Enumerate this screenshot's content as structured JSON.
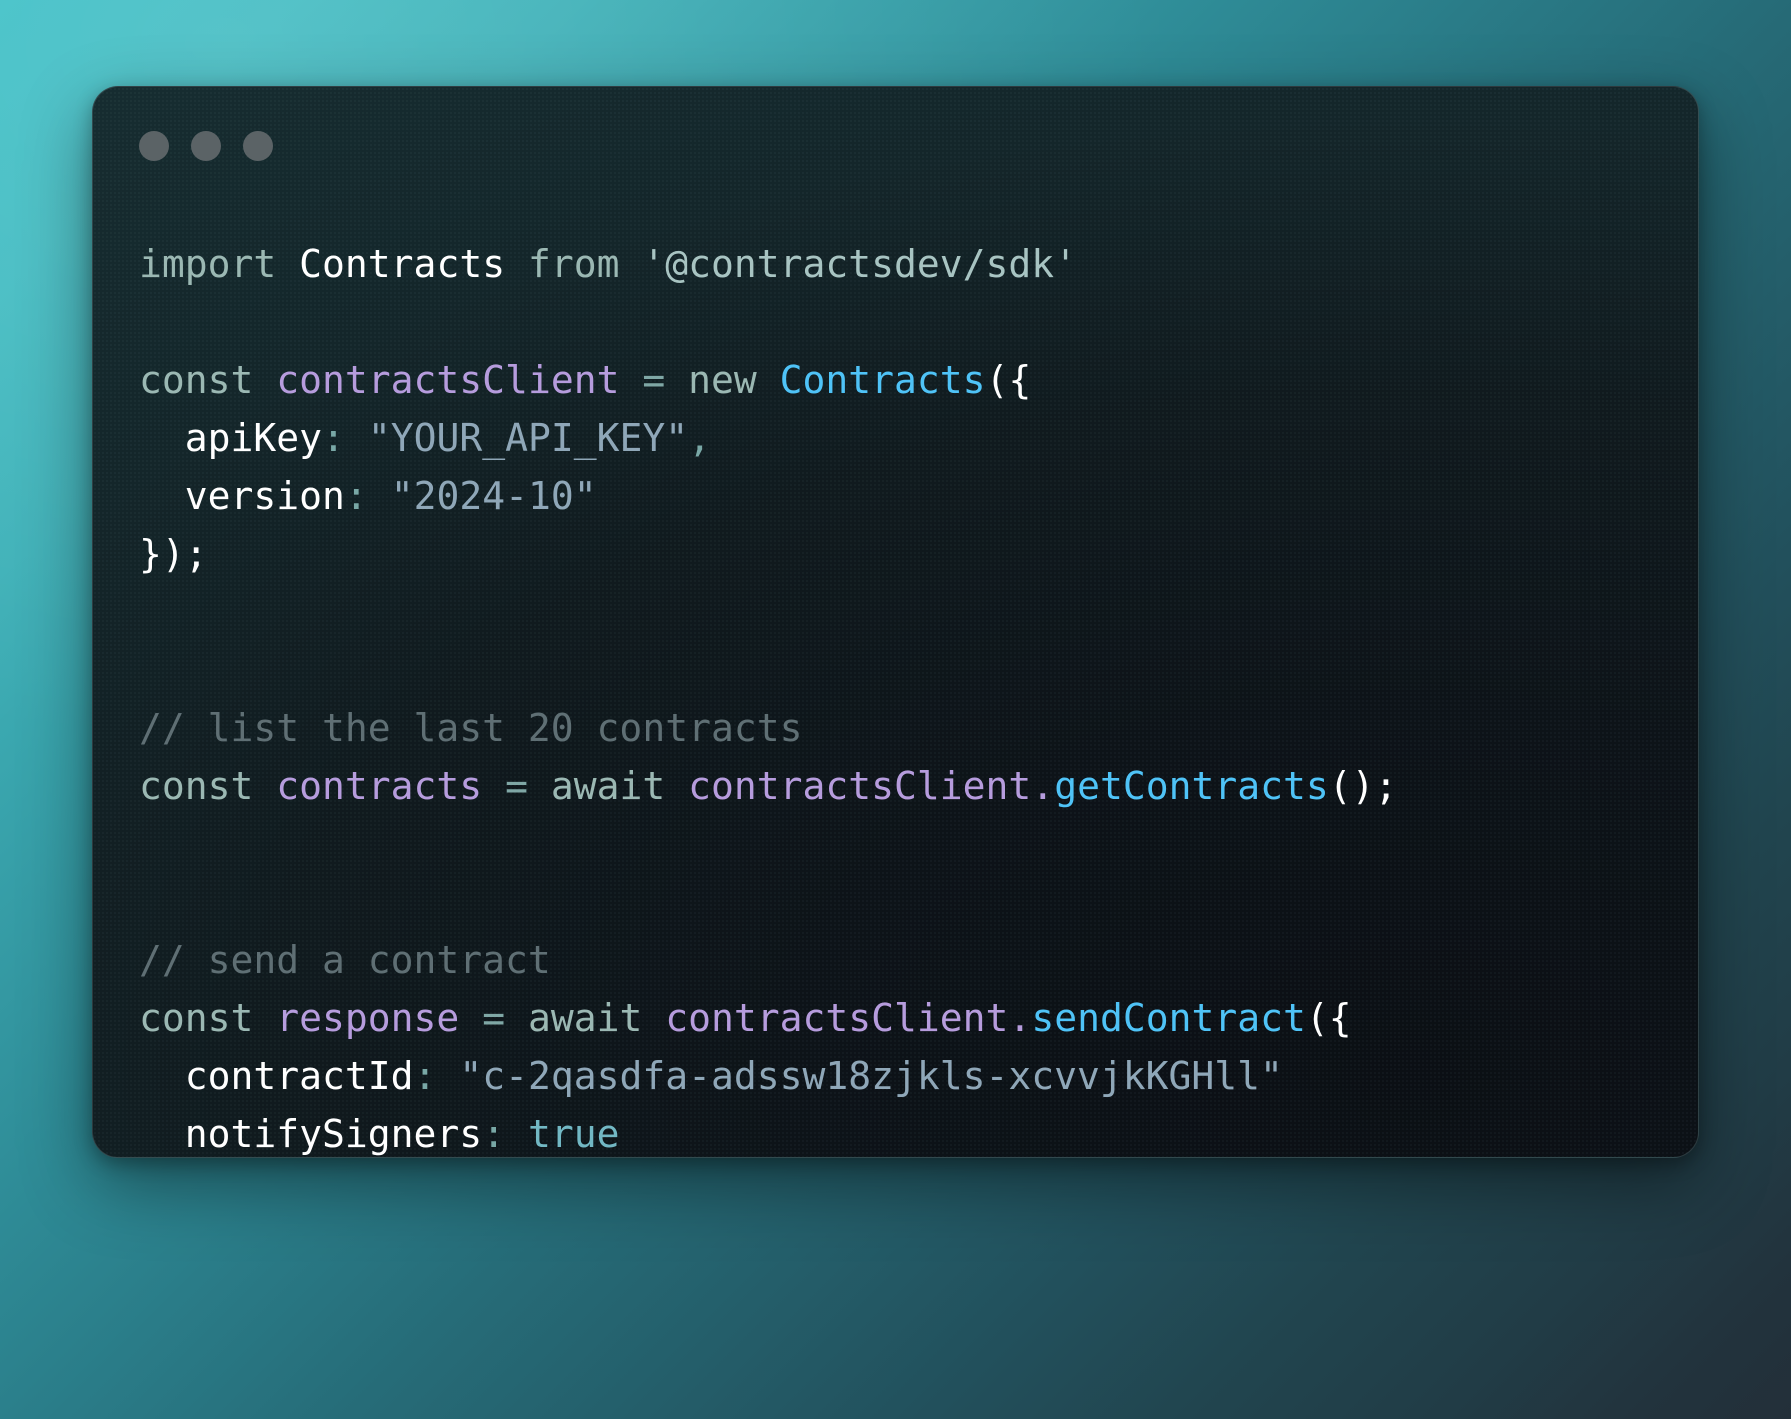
{
  "theme": {
    "background_gradient_start": "#3fc0c7",
    "background_gradient_end": "#232f39",
    "window_background": "#0d1318",
    "window_border": "#a0c8cd",
    "dot_color": "#5b6366",
    "color_keyword": "#9bb8b3",
    "color_class": "#ffffff",
    "color_type": "#4fc3f7",
    "color_variable": "#b69cdd",
    "color_property": "#ffffff",
    "color_string": "#8fa7b8",
    "color_comment": "#5f6f74",
    "color_operator": "#7fa7a5",
    "color_punctuation": "#ffffff",
    "color_boolean": "#72b8c4"
  },
  "window": {
    "dots": [
      {
        "name": "close-dot"
      },
      {
        "name": "minimize-dot"
      },
      {
        "name": "maximize-dot"
      }
    ]
  },
  "code": {
    "language": "javascript",
    "package_name": "@contractsdev/sdk",
    "class_name": "Contracts",
    "client_variable": "contractsClient",
    "api_key_value": "YOUR_API_KEY",
    "version_value": "2024-10",
    "contract_id_value": "c-2qasdfa-adssw18zjkls-xcvvjkKGHll",
    "notify_signers_value": "true",
    "comment_list": "// list the last 20 contracts",
    "comment_send": "// send a contract",
    "lines": [
      {
        "id": "line-import",
        "tokens": [
          {
            "t": "import",
            "c": "keyword"
          },
          {
            "t": " ",
            "c": "plain"
          },
          {
            "t": "Contracts",
            "c": "class"
          },
          {
            "t": " ",
            "c": "plain"
          },
          {
            "t": "from",
            "c": "keyword"
          },
          {
            "t": " ",
            "c": "plain"
          },
          {
            "t": "'@contractsdev/sdk'",
            "c": "import-str"
          }
        ]
      },
      {
        "id": "line-blank-1",
        "tokens": []
      },
      {
        "id": "line-const-client",
        "tokens": [
          {
            "t": "const",
            "c": "keyword"
          },
          {
            "t": " ",
            "c": "plain"
          },
          {
            "t": "contractsClient",
            "c": "variable"
          },
          {
            "t": " ",
            "c": "plain"
          },
          {
            "t": "=",
            "c": "operator"
          },
          {
            "t": " ",
            "c": "plain"
          },
          {
            "t": "new",
            "c": "keyword"
          },
          {
            "t": " ",
            "c": "plain"
          },
          {
            "t": "Contracts",
            "c": "type"
          },
          {
            "t": "({",
            "c": "punct"
          }
        ]
      },
      {
        "id": "line-apikey",
        "tokens": [
          {
            "t": "  ",
            "c": "plain"
          },
          {
            "t": "apiKey",
            "c": "property"
          },
          {
            "t": ":",
            "c": "colon"
          },
          {
            "t": " ",
            "c": "plain"
          },
          {
            "t": "\"YOUR_API_KEY\"",
            "c": "string"
          },
          {
            "t": ",",
            "c": "colon"
          }
        ]
      },
      {
        "id": "line-version",
        "tokens": [
          {
            "t": "  ",
            "c": "plain"
          },
          {
            "t": "version",
            "c": "property"
          },
          {
            "t": ":",
            "c": "colon"
          },
          {
            "t": " ",
            "c": "plain"
          },
          {
            "t": "\"2024-10\"",
            "c": "string"
          }
        ]
      },
      {
        "id": "line-close-client",
        "tokens": [
          {
            "t": "});",
            "c": "punct"
          }
        ]
      },
      {
        "id": "line-blank-2",
        "tokens": []
      },
      {
        "id": "line-blank-3",
        "tokens": []
      },
      {
        "id": "line-comment-list",
        "tokens": [
          {
            "t": "// list the last 20 contracts",
            "c": "comment"
          }
        ]
      },
      {
        "id": "line-get-contracts",
        "tokens": [
          {
            "t": "const",
            "c": "keyword"
          },
          {
            "t": " ",
            "c": "plain"
          },
          {
            "t": "contracts",
            "c": "variable"
          },
          {
            "t": " ",
            "c": "plain"
          },
          {
            "t": "=",
            "c": "operator"
          },
          {
            "t": " ",
            "c": "plain"
          },
          {
            "t": "await",
            "c": "keyword"
          },
          {
            "t": " ",
            "c": "plain"
          },
          {
            "t": "contractsClient",
            "c": "variable"
          },
          {
            "t": ".",
            "c": "dot"
          },
          {
            "t": "getContracts",
            "c": "method"
          },
          {
            "t": "();",
            "c": "punct"
          }
        ]
      },
      {
        "id": "line-blank-4",
        "tokens": []
      },
      {
        "id": "line-blank-5",
        "tokens": []
      },
      {
        "id": "line-comment-send",
        "tokens": [
          {
            "t": "// send a contract",
            "c": "comment"
          }
        ]
      },
      {
        "id": "line-send-contract",
        "tokens": [
          {
            "t": "const",
            "c": "keyword"
          },
          {
            "t": " ",
            "c": "plain"
          },
          {
            "t": "response",
            "c": "variable"
          },
          {
            "t": " ",
            "c": "plain"
          },
          {
            "t": "=",
            "c": "operator"
          },
          {
            "t": " ",
            "c": "plain"
          },
          {
            "t": "await",
            "c": "keyword"
          },
          {
            "t": " ",
            "c": "plain"
          },
          {
            "t": "contractsClient",
            "c": "variable"
          },
          {
            "t": ".",
            "c": "dot"
          },
          {
            "t": "sendContract",
            "c": "method"
          },
          {
            "t": "({",
            "c": "punct"
          }
        ]
      },
      {
        "id": "line-contract-id",
        "tokens": [
          {
            "t": "  ",
            "c": "plain"
          },
          {
            "t": "contractId",
            "c": "property"
          },
          {
            "t": ":",
            "c": "colon"
          },
          {
            "t": " ",
            "c": "plain"
          },
          {
            "t": "\"c-2qasdfa-adssw18zjkls-xcvvjkKGHll\"",
            "c": "string"
          }
        ]
      },
      {
        "id": "line-notify-signers",
        "tokens": [
          {
            "t": "  ",
            "c": "plain"
          },
          {
            "t": "notifySigners",
            "c": "property"
          },
          {
            "t": ":",
            "c": "colon"
          },
          {
            "t": " ",
            "c": "plain"
          },
          {
            "t": "true",
            "c": "bool"
          }
        ]
      },
      {
        "id": "line-close-send",
        "tokens": [
          {
            "t": "});",
            "c": "punct"
          }
        ]
      }
    ]
  }
}
